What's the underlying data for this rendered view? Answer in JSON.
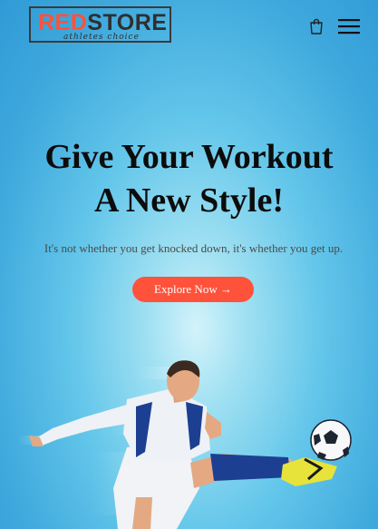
{
  "header": {
    "logo": {
      "part1": "RED",
      "part2": "STORE",
      "tagline": "athletes choice"
    },
    "icons": {
      "cart": "shopping-bag-icon",
      "menu": "hamburger-menu-icon"
    }
  },
  "hero": {
    "title_line1": "Give Your Workout",
    "title_line2": "A New Style!",
    "subtitle": "It's not whether you get knocked down, it's whether you get up.",
    "cta_label": "Explore Now →",
    "image": "soccer-player-kicking-ball"
  },
  "colors": {
    "accent": "#ff523b",
    "background": "#3fa9dd",
    "text": "#0c0c0c"
  }
}
